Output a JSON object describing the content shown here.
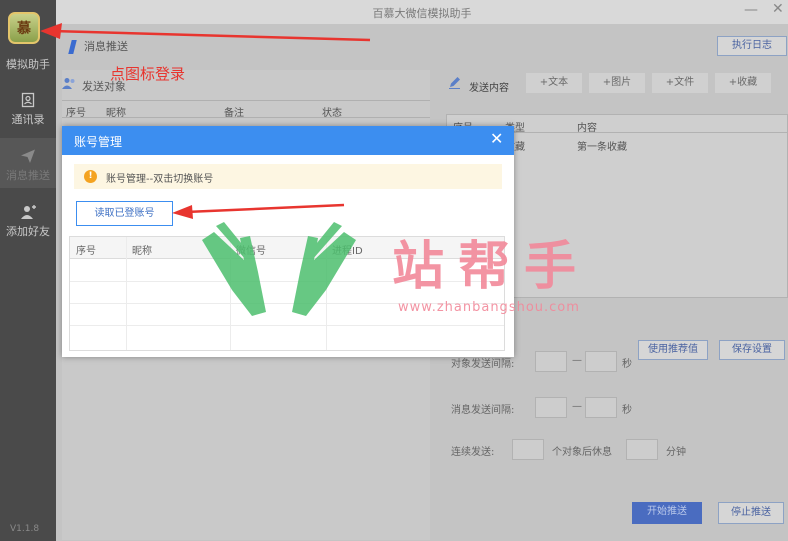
{
  "window": {
    "title": "百慕大微信模拟助手",
    "minimize": "—",
    "close": "✕"
  },
  "sidebar": {
    "logo_glyph": "慕",
    "items": [
      {
        "label": "模拟助手"
      },
      {
        "label": "通讯录"
      },
      {
        "label": "消息推送"
      },
      {
        "label": "添加好友"
      }
    ],
    "version": "V1.1.8"
  },
  "header": {
    "tab_label": "消息推送",
    "exec_log_button": "执行日志"
  },
  "left_panel": {
    "title": "发送对象",
    "columns": [
      "序号",
      "昵称",
      "备注",
      "状态"
    ]
  },
  "right_panel": {
    "title": "发送内容",
    "add_buttons": [
      "+文本",
      "+图片",
      "+文件",
      "+收藏"
    ],
    "columns": [
      "序号",
      "类型",
      "内容"
    ],
    "rows": [
      {
        "type": "收藏",
        "content": "第一条收藏"
      }
    ],
    "use_recommended_button": "使用推荐值",
    "save_settings_button": "保存设置",
    "target_interval_label": "对象发送间隔:",
    "message_interval_label": "消息发送间隔:",
    "range_sep": "—",
    "seconds_unit": "秒",
    "continuous_label": "连续发送:",
    "rest_after_label": "个对象后休息",
    "minutes_unit": "分钟",
    "start_button": "开始推送",
    "stop_button": "停止推送"
  },
  "dialog": {
    "title": "账号管理",
    "close": "✕",
    "notice_icon": "!",
    "notice": "账号管理--双击切换账号",
    "read_button": "读取已登账号",
    "columns": [
      "序号",
      "昵称",
      "微信号",
      "进程ID"
    ]
  },
  "annotation": {
    "text": "点图标登录",
    "color": "#e8352f"
  },
  "watermark": {
    "text": "站帮手",
    "url": "www.zhanbangshou.com",
    "color": "#f2899a",
    "hands_color": "#4dbf6e"
  },
  "colors": {
    "dialog_header": "#3c8ef0",
    "primary_button": "#3c6fc3"
  }
}
